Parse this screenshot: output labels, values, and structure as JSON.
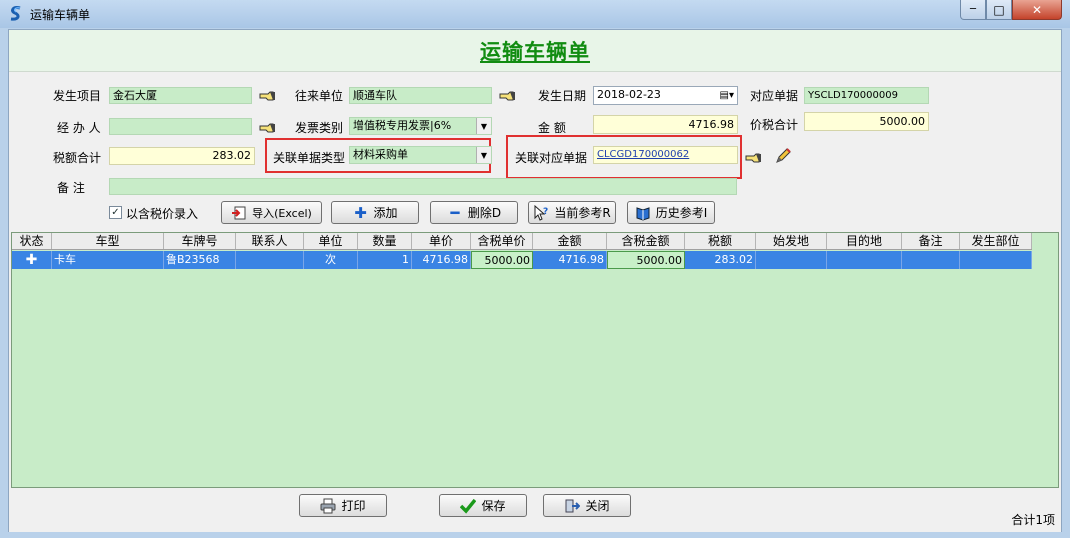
{
  "window": {
    "title": "运输车辆单",
    "minimize_glyph": "─",
    "maximize_glyph": "□",
    "close_glyph": "✕"
  },
  "form": {
    "title": "运输车辆单",
    "labels": {
      "project": "发生项目",
      "partner": "往来单位",
      "date": "发生日期",
      "ref_doc": "对应单据",
      "handler": "经 办 人",
      "invoice_type": "发票类别",
      "amount": "金    额",
      "total_with_tax": "价税合计",
      "tax_total": "税额合计",
      "linked_type": "关联单据类型",
      "linked_doc": "关联对应单据",
      "remark": "备    注"
    },
    "values": {
      "project": "金石大厦",
      "partner": "顺通车队",
      "date": "2018-02-23",
      "ref_doc": "YSCLD170000009",
      "handler": "",
      "invoice_type": "增值税专用发票|6%",
      "amount": "4716.98",
      "total_with_tax": "5000.00",
      "tax_total": "283.02",
      "linked_type": "材料采购单",
      "linked_doc": "CLCGD170000062",
      "remark": ""
    }
  },
  "toolbar": {
    "tax_inclusive_label": "以含税价录入",
    "tax_inclusive_checked": true,
    "import_label": "导入(Excel)",
    "add_label": "添加",
    "delete_label": "删除D",
    "current_ref_label": "当前参考R",
    "history_ref_label": "历史参考I"
  },
  "grid": {
    "columns": [
      "状态",
      "车型",
      "车牌号",
      "联系人",
      "单位",
      "数量",
      "单价",
      "含税单价",
      "金额",
      "含税金额",
      "税额",
      "始发地",
      "目的地",
      "备注",
      "发生部位"
    ],
    "rows": [
      {
        "status_icon": "plus-icon",
        "type": "卡车",
        "plate": "鲁B23568",
        "contact": "",
        "unit": "次",
        "qty": "1",
        "price": "4716.98",
        "price_tax": "5000.00",
        "amount": "4716.98",
        "amount_tax": "5000.00",
        "tax": "283.02",
        "origin": "",
        "dest": "",
        "remark": "",
        "part": ""
      }
    ]
  },
  "footer": {
    "print_label": "打印",
    "save_label": "保存",
    "close_label": "关闭",
    "count_text": "合计1项"
  },
  "colors": {
    "title_green": "#118c11",
    "field_green": "#c8ecc8",
    "field_yellow": "#ffffd8",
    "highlight_red": "#e03030",
    "row_selected": "#3a84e4"
  }
}
